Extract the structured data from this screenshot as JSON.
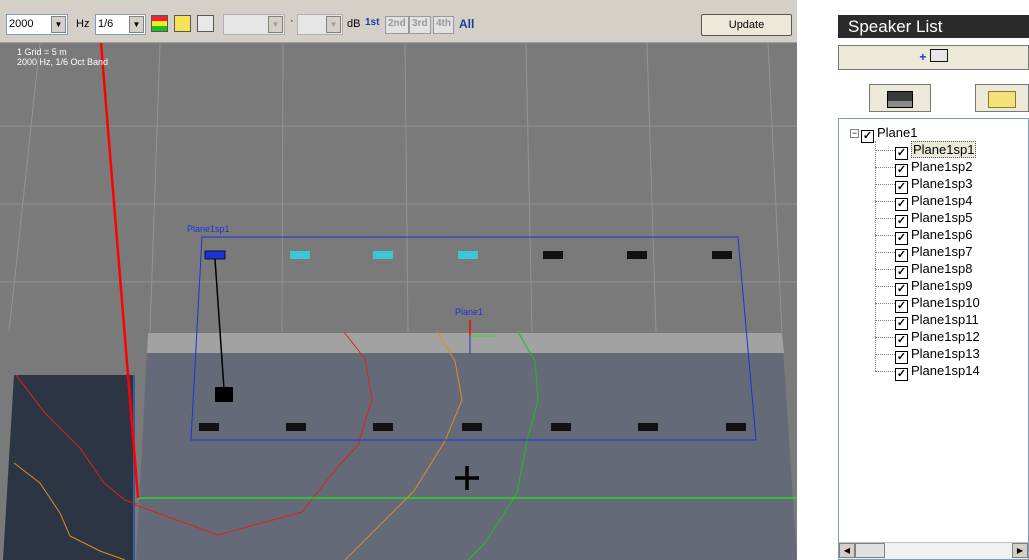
{
  "toolbar": {
    "frequency_value": "2000",
    "hz_label": "Hz",
    "band_value": "1/6",
    "db_label": "dB",
    "dot_label": "·",
    "orders": [
      "1st",
      "2nd",
      "3rd",
      "4th",
      "All"
    ],
    "update_label": "Update"
  },
  "viewport": {
    "grid_info": "1 Grid = 5 m",
    "band_info": "2000 Hz, 1/6 Oct Band",
    "speaker_label": "Plane1sp1",
    "plane_label": "Plane1",
    "colors": {
      "contour_red": "#e02020",
      "contour_orange": "#e58a1f",
      "contour_green": "#22bb22",
      "plane_blue": "#1e33d6",
      "axis_red": "#ff0000"
    }
  },
  "panel": {
    "title": "Speaker List",
    "add_button": "+",
    "tree": {
      "root": "Plane1",
      "children": [
        "Plane1sp1",
        "Plane1sp2",
        "Plane1sp3",
        "Plane1sp4",
        "Plane1sp5",
        "Plane1sp6",
        "Plane1sp7",
        "Plane1sp8",
        "Plane1sp9",
        "Plane1sp10",
        "Plane1sp11",
        "Plane1sp12",
        "Plane1sp13",
        "Plane1sp14"
      ],
      "selected": "Plane1sp1"
    }
  }
}
